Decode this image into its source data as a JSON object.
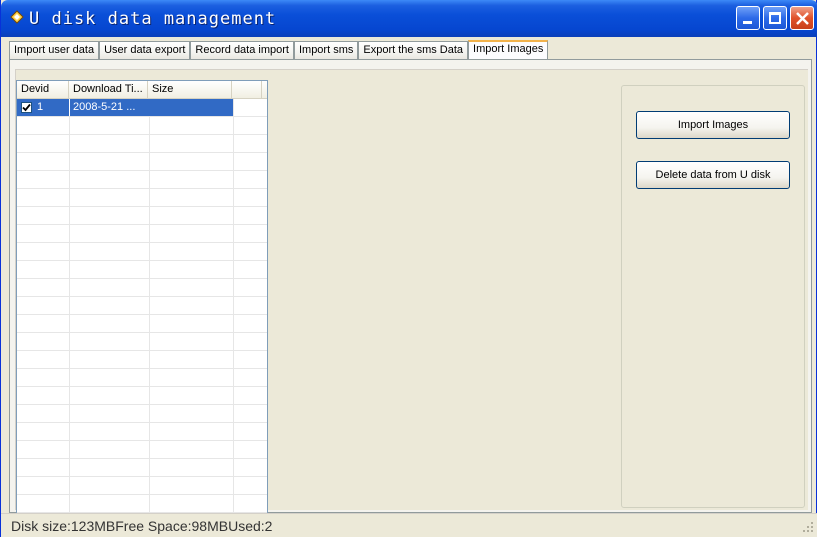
{
  "window": {
    "title": "U disk data management",
    "icon": "diamond-arrow-icon"
  },
  "titlebar_buttons": {
    "minimize": "minimize-icon",
    "maximize": "maximize-icon",
    "close": "close-icon"
  },
  "tabs": [
    {
      "label": "Import user data",
      "active": false
    },
    {
      "label": "User data export",
      "active": false
    },
    {
      "label": "Record data import",
      "active": false
    },
    {
      "label": "Import sms",
      "active": false
    },
    {
      "label": "Export the sms Data",
      "active": false
    },
    {
      "label": "Import Images",
      "active": true
    }
  ],
  "list": {
    "columns": [
      "Devid",
      "Download Ti...",
      "Size"
    ],
    "rows": [
      {
        "checked": true,
        "devid": "1",
        "download_time": "2008-5-21 ...",
        "size": "",
        "selected": true
      }
    ]
  },
  "buttons": {
    "import_images": "Import Images",
    "delete_data": "Delete data from U disk"
  },
  "status": {
    "text": "Disk size:123MBFree Space:98MBUsed:2"
  },
  "colors": {
    "titlebar": "#0a4fd8",
    "selection": "#316ac5",
    "active_tab_accent": "#f2b24a",
    "close_button": "#e0522b"
  }
}
